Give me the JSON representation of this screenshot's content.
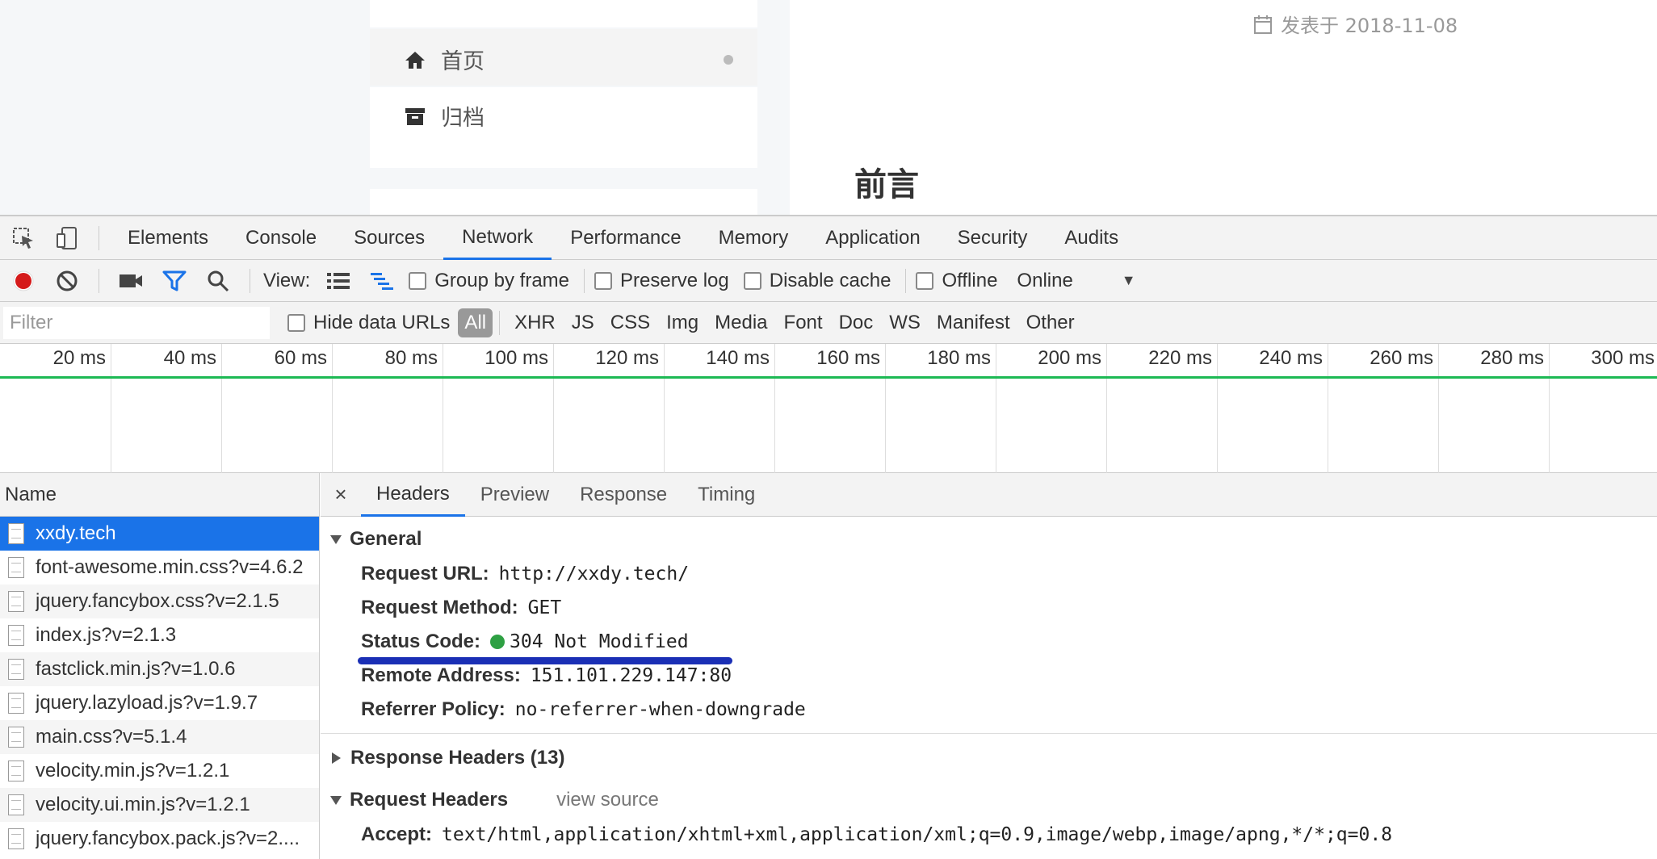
{
  "page": {
    "menu": {
      "home_label": "首页",
      "archive_label": "归档"
    },
    "post": {
      "meta": "发表于 2018-11-08",
      "heading": "前言"
    }
  },
  "devtools": {
    "tabs": [
      "Elements",
      "Console",
      "Sources",
      "Network",
      "Performance",
      "Memory",
      "Application",
      "Security",
      "Audits"
    ],
    "active_tab": "Network",
    "toolbar": {
      "view_label": "View:",
      "group_by_frame": "Group by frame",
      "preserve_log": "Preserve log",
      "disable_cache": "Disable cache",
      "offline": "Offline",
      "throttling": "Online"
    },
    "filter": {
      "placeholder": "Filter",
      "hide_data_urls": "Hide data URLs",
      "types": [
        "All",
        "XHR",
        "JS",
        "CSS",
        "Img",
        "Media",
        "Font",
        "Doc",
        "WS",
        "Manifest",
        "Other"
      ],
      "active_type": "All"
    },
    "timeline": {
      "ticks": [
        "20 ms",
        "40 ms",
        "60 ms",
        "80 ms",
        "100 ms",
        "120 ms",
        "140 ms",
        "160 ms",
        "180 ms",
        "200 ms",
        "220 ms",
        "240 ms",
        "260 ms",
        "280 ms",
        "300 ms"
      ]
    },
    "requests": {
      "header": "Name",
      "items": [
        "xxdy.tech",
        "font-awesome.min.css?v=4.6.2",
        "jquery.fancybox.css?v=2.1.5",
        "index.js?v=2.1.3",
        "fastclick.min.js?v=1.0.6",
        "jquery.lazyload.js?v=1.9.7",
        "main.css?v=5.1.4",
        "velocity.min.js?v=1.2.1",
        "velocity.ui.min.js?v=1.2.1",
        "jquery.fancybox.pack.js?v=2...."
      ],
      "selected": "xxdy.tech"
    },
    "details": {
      "close": "×",
      "tabs": [
        "Headers",
        "Preview",
        "Response",
        "Timing"
      ],
      "active_tab": "Headers",
      "general": {
        "title": "General",
        "request_url_key": "Request URL:",
        "request_url": "http://xxdy.tech/",
        "request_method_key": "Request Method:",
        "request_method": "GET",
        "status_code_key": "Status Code:",
        "status_code": "304 Not Modified",
        "status_color": "#2ea043",
        "remote_address_key": "Remote Address:",
        "remote_address": "151.101.229.147:80",
        "referrer_policy_key": "Referrer Policy:",
        "referrer_policy": "no-referrer-when-downgrade"
      },
      "response_headers": {
        "title": "Response Headers (13)"
      },
      "request_headers": {
        "title": "Request Headers",
        "view_source": "view source",
        "accept_key": "Accept:",
        "accept": "text/html,application/xhtml+xml,application/xml;q=0.9,image/webp,image/apng,*/*;q=0.8"
      }
    }
  }
}
